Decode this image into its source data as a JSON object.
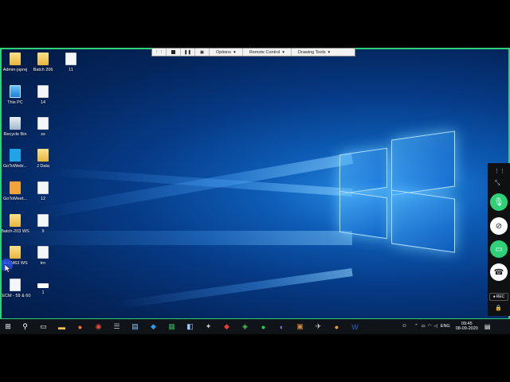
{
  "remote_toolbar": {
    "menus": [
      {
        "label": "Options"
      },
      {
        "label": "Remote Control"
      },
      {
        "label": "Drawing Tools"
      }
    ]
  },
  "desktop_icons": [
    {
      "label": "Admin-jsprej",
      "type": "folder"
    },
    {
      "label": "Batch 206",
      "type": "folder"
    },
    {
      "label": "11",
      "type": "doc"
    },
    {
      "label": "This PC",
      "type": "pc"
    },
    {
      "label": "14",
      "type": "doc"
    },
    {
      "label": "Recycle Bin",
      "type": "bin"
    },
    {
      "label": "ss",
      "type": "doc"
    },
    {
      "label": "GoToWebi...",
      "type": "snow"
    },
    {
      "label": "J Data",
      "type": "folder"
    },
    {
      "label": "GoToMeet...",
      "type": "goto"
    },
    {
      "label": "12",
      "type": "doc"
    },
    {
      "label": "Batch-203 WS",
      "type": "folder"
    },
    {
      "label": "9",
      "type": "doc"
    },
    {
      "label": "JECM63 WS",
      "type": "folder"
    },
    {
      "label": "trn",
      "type": "doc"
    },
    {
      "label": "JECM - 59 & 60",
      "type": "doc"
    },
    {
      "label": "1",
      "type": "bar"
    }
  ],
  "side_panel": {
    "rec_label": "REC",
    "buttons": [
      "mic-icon",
      "camera-off-icon",
      "screen-share-icon",
      "hang-up-icon"
    ]
  },
  "taskbar": {
    "apps": [
      "start-icon",
      "search-icon",
      "task-view-icon",
      "file-explorer-icon",
      "firefox-icon",
      "chrome-icon",
      "database-icon",
      "notepad-icon",
      "vscode-icon",
      "excel-icon",
      "windows-icon",
      "tool-icon",
      "anydesk-icon",
      "app-icon",
      "spotify-icon",
      "app2-icon",
      "app3-icon",
      "app4-icon",
      "app5-icon",
      "word-icon"
    ],
    "language": "ENG",
    "time": "09:45",
    "date": "08-09-2020"
  }
}
